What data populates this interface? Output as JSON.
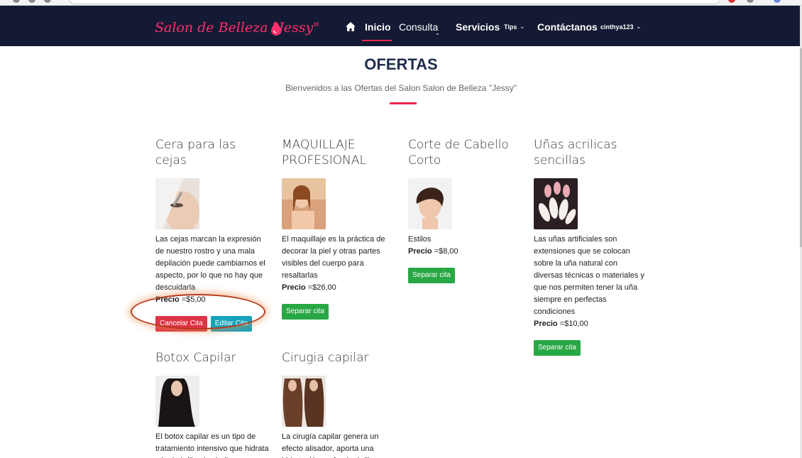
{
  "navbar": {
    "brand": "Salon de Belleza \"Jessy\"",
    "items": [
      {
        "label": "Inicio"
      },
      {
        "label": "Consulta"
      },
      {
        "label": "Servicios"
      },
      {
        "label": "Tips"
      },
      {
        "label": "Contáctanos"
      },
      {
        "label": "cinthya123"
      }
    ]
  },
  "header": {
    "title": "OFERTAS",
    "subtitle": "Bienvenidos a las Ofertas del Salon Salon de Belleza \"Jessy\""
  },
  "cards": [
    {
      "title": "Cera para las cejas",
      "description": "Las cejas marcan la expresión de nuestro rostro y una mala depilación puede cambiarnos el aspecto, por lo que no hay que descuidarla",
      "price_label": "Precio",
      "price_value": "=$5,00",
      "buttons": [
        "Cancelar Cita",
        "Editar Cita"
      ]
    },
    {
      "title": "MAQUILLAJE PROFESIONAL",
      "description": "El maquillaje es la práctica de decorar la piel y otras partes visibles del cuerpo para resaltarlas",
      "price_label": "Precio",
      "price_value": "=$26,00",
      "buttons": [
        "Separar cita"
      ]
    },
    {
      "title": "Corte de Cabello Corto",
      "description": "Estilos",
      "price_label": "Precio",
      "price_value": "=$8,00",
      "buttons": [
        "Separar cita"
      ]
    },
    {
      "title": "Uñas acrilicas sencillas",
      "description": "Las uñas artificiales son extensiones que se colocan sobre la uña natural con diversas técnicas o materiales y que nos permiten tener la uña siempre en perfectas condiciones",
      "price_label": "Precio",
      "price_value": "=$10,00",
      "buttons": [
        "Separar cita"
      ]
    },
    {
      "title": "Botox Capilar",
      "description": "El botox capilar es un tipo de tratamiento intensivo que hidrata y le da brillo al cabello, dejándolo"
    },
    {
      "title": "Cirugia capilar",
      "description": "La cirugía capilar genera un efecto alisador, aporta una hidratación profunda, brillo"
    }
  ],
  "icons": {
    "home": "home-icon",
    "brand": "water-drop-icon",
    "caret": "chevron-down-icon"
  },
  "colors": {
    "navbar": "#141a33",
    "accent": "#e8284e",
    "green": "#28a745",
    "red": "#dc3545",
    "teal": "#17a2b8"
  }
}
